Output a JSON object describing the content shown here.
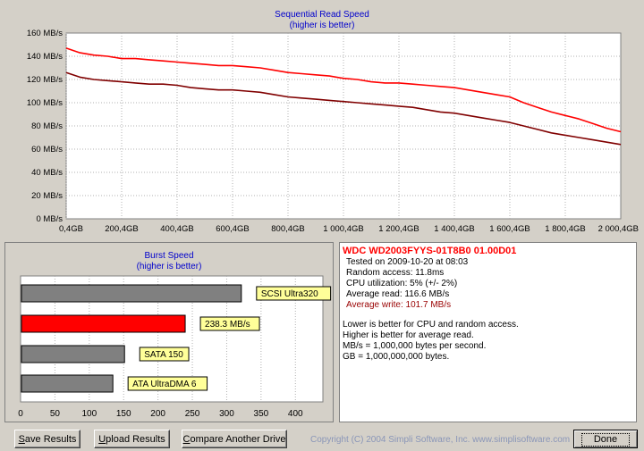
{
  "sequential": {
    "title": "Sequential Read Speed",
    "subtitle": "(higher is better)",
    "y_ticks": [
      "160 MB/s",
      "140 MB/s",
      "120 MB/s",
      "100 MB/s",
      "80 MB/s",
      "60 MB/s",
      "40 MB/s",
      "20 MB/s",
      "0 MB/s"
    ],
    "x_ticks": [
      "0,4GB",
      "200,4GB",
      "400,4GB",
      "600,4GB",
      "800,4GB",
      "1 000,4GB",
      "1 200,4GB",
      "1 400,4GB",
      "1 600,4GB",
      "1 800,4GB",
      "2 000,4GB"
    ]
  },
  "chart_data": {
    "type": "line",
    "title": "Sequential Read Speed",
    "subtitle": "(higher is better)",
    "ylim": [
      0,
      160
    ],
    "xlim": [
      0.4,
      2000.4
    ],
    "series": [
      {
        "color": "#ff0000",
        "x": [
          0.4,
          50,
          100,
          150,
          200,
          250,
          300,
          350,
          400,
          450,
          500,
          550,
          600,
          650,
          700,
          750,
          800,
          850,
          900,
          950,
          1000,
          1050,
          1100,
          1150,
          1200,
          1250,
          1300,
          1350,
          1400,
          1450,
          1500,
          1550,
          1600,
          1650,
          1700,
          1750,
          1800,
          1850,
          1900,
          1950,
          2000.4
        ],
        "values": [
          147,
          143,
          141,
          140,
          138,
          138,
          137,
          136,
          135,
          134,
          133,
          132,
          132,
          131,
          130,
          128,
          126,
          125,
          124,
          123,
          121,
          120,
          118,
          117,
          117,
          116,
          115,
          114,
          113,
          111,
          109,
          107,
          105,
          100,
          96,
          92,
          89,
          86,
          82,
          78,
          75
        ]
      },
      {
        "color": "#800000",
        "x": [
          0.4,
          50,
          100,
          150,
          200,
          250,
          300,
          350,
          400,
          450,
          500,
          550,
          600,
          650,
          700,
          750,
          800,
          850,
          900,
          950,
          1000,
          1050,
          1100,
          1150,
          1200,
          1250,
          1300,
          1350,
          1400,
          1450,
          1500,
          1550,
          1600,
          1650,
          1700,
          1750,
          1800,
          1850,
          1900,
          1950,
          2000.4
        ],
        "values": [
          126,
          122,
          120,
          119,
          118,
          117,
          116,
          116,
          115,
          113,
          112,
          111,
          111,
          110,
          109,
          107,
          105,
          104,
          103,
          102,
          101,
          100,
          99,
          98,
          97,
          96,
          94,
          92,
          91,
          89,
          87,
          85,
          83,
          80,
          77,
          74,
          72,
          70,
          68,
          66,
          64
        ]
      }
    ]
  },
  "burst": {
    "title": "Burst Speed",
    "subtitle": "(higher is better)",
    "x_ticks": [
      "0",
      "50",
      "100",
      "150",
      "200",
      "250",
      "300",
      "350",
      "400"
    ],
    "chart_data": {
      "type": "bar",
      "categories": [
        "SCSI Ultra320",
        "238.3 MB/s",
        "SATA 150",
        "ATA UltraDMA 6"
      ],
      "values": [
        320,
        238.3,
        150,
        133
      ],
      "colors": [
        "#808080",
        "#ff0000",
        "#808080",
        "#808080"
      ],
      "xlim": [
        0,
        440
      ]
    }
  },
  "info": {
    "drive": "WDC WD2003FYYS-01T8B0 01.00D01",
    "tested": "Tested on 2009-10-20 at 08:03",
    "random_access": "Random access: 11.8ms",
    "cpu": "CPU utilization: 5% (+/- 2%)",
    "avg_read": "Average read: 116.6 MB/s",
    "avg_write": "Average write: 101.7 MB/s",
    "note1": "Lower is better for CPU and random access.",
    "note2": "Higher is better for average read.",
    "note3": "MB/s = 1,000,000 bytes per second.",
    "note4": "GB = 1,000,000,000 bytes."
  },
  "buttons": {
    "save_first": "S",
    "save_rest": "ave Results",
    "upload_first": "U",
    "upload_rest": "pload Results",
    "compare_first": "C",
    "compare_rest": "ompare Another Drive",
    "done": "Done"
  },
  "copyright": "Copyright (C) 2004 Simpli Software, Inc. www.simplisoftware.com"
}
